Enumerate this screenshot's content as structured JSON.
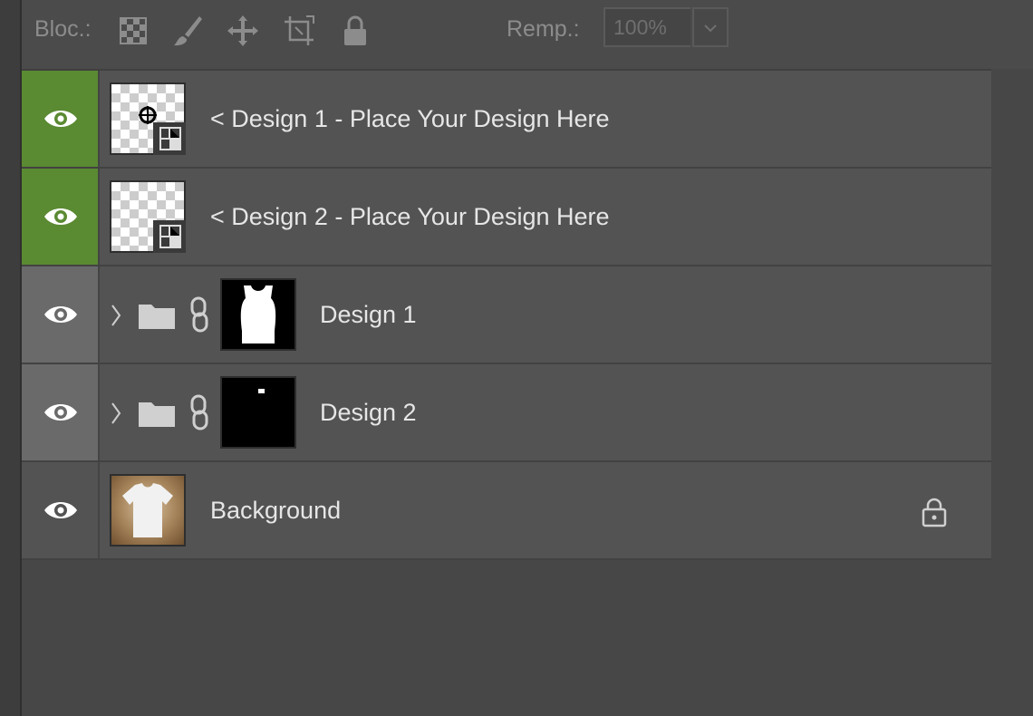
{
  "toolbar": {
    "lock_label": "Bloc.:",
    "fill_label": "Remp.:",
    "fill_value": "100%",
    "tools": [
      "lock-transparent-pixels-icon",
      "lock-image-pixels-icon",
      "lock-position-icon",
      "lock-artboard-icon",
      "lock-all-icon"
    ]
  },
  "layers": [
    {
      "name": "< Design 1 - Place Your Design Here",
      "type": "smart-object",
      "visible": true,
      "selected": true
    },
    {
      "name": "< Design 2 - Place Your Design Here",
      "type": "smart-object",
      "visible": true,
      "selected": true
    },
    {
      "name": "Design 1",
      "type": "group",
      "visible": true,
      "collapsed": true
    },
    {
      "name": "Design 2",
      "type": "group",
      "visible": true,
      "collapsed": true
    },
    {
      "name": "Background",
      "type": "image",
      "visible": true,
      "locked": true
    }
  ],
  "colors": {
    "selected_eye_bg": "#5a8a32",
    "group_eye_bg": "#6a6a6a",
    "row_bg": "#535353",
    "panel_bg": "#474747"
  }
}
